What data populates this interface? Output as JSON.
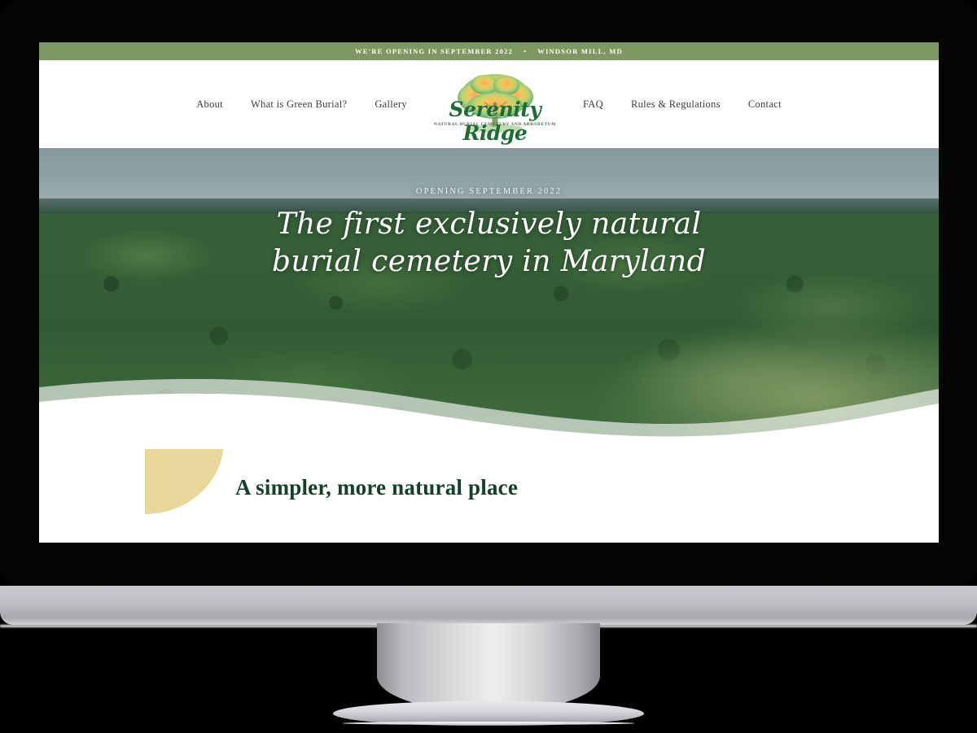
{
  "announcement": {
    "text": "WE'RE OPENING IN SEPTEMBER 2022",
    "separator": "•",
    "location": "WINDSOR MILL, MD",
    "background_color": "#7d9862"
  },
  "nav": {
    "left_items": [
      {
        "label": "About"
      },
      {
        "label": "What is Green Burial?"
      },
      {
        "label": "Gallery"
      }
    ],
    "right_items": [
      {
        "label": "FAQ"
      },
      {
        "label": "Rules & Regulations"
      },
      {
        "label": "Contact"
      }
    ],
    "text_color": "#3b3b3b"
  },
  "logo": {
    "name": "Serenity Ridge",
    "tagline": "NATURAL BURIAL CEMETERY AND ARBORETUM",
    "icon": "tree-icon",
    "word_color": "#1f6b35"
  },
  "hero": {
    "eyebrow": "OPENING SEPTEMBER 2022",
    "headline_line1": "The first exclusively natural",
    "headline_line2": "burial cemetery in Maryland",
    "image_description": "aerial view of green forest canopy and meadow under hazy sky",
    "text_color": "#ffffff"
  },
  "section": {
    "title": "A simpler, more natural place",
    "title_color": "#14402a",
    "accent_shape_color": "#e8d79a"
  },
  "device": {
    "type": "desktop-monitor",
    "bezel_color": "#050505",
    "chin_color": "#bdbfc2"
  }
}
